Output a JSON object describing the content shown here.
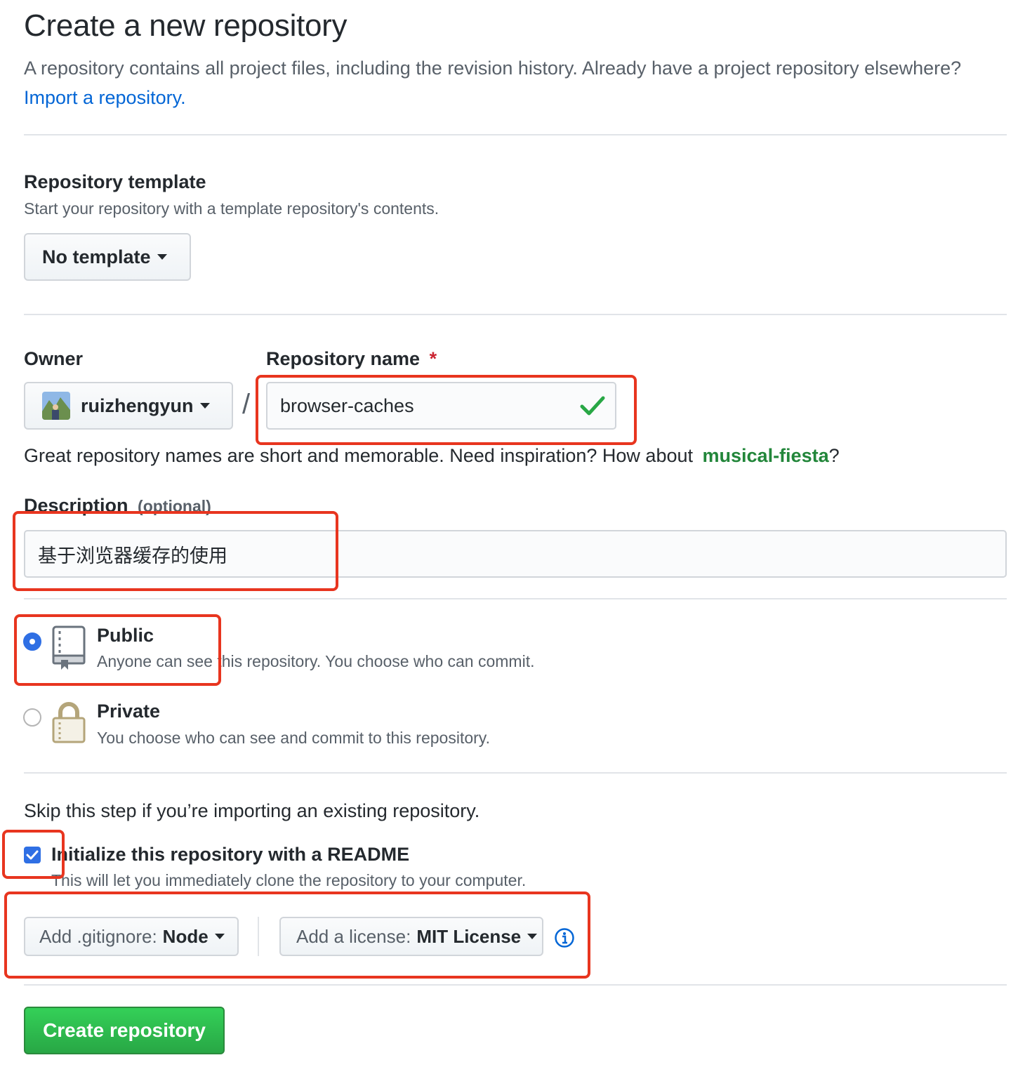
{
  "header": {
    "title": "Create a new repository",
    "subtitle_text": "A repository contains all project files, including the revision history. Already have a project repository elsewhere?",
    "import_link": "Import a repository."
  },
  "template": {
    "heading": "Repository template",
    "note": "Start your repository with a template repository's contents.",
    "button_label": "No template"
  },
  "owner": {
    "label": "Owner",
    "value": "ruizhengyun"
  },
  "separator": "/",
  "repo_name": {
    "label": "Repository name",
    "required_mark": "*",
    "value": "browser-caches"
  },
  "suggestion": {
    "prefix": "Great repository names are short and memorable. Need inspiration? How about",
    "name": "musical-fiesta",
    "suffix": "?"
  },
  "description": {
    "label": "Description",
    "optional": "(optional)",
    "value": "基于浏览器缓存的使用"
  },
  "visibility": {
    "public": {
      "title": "Public",
      "note": "Anyone can see this repository. You choose who can commit.",
      "selected": true
    },
    "private": {
      "title": "Private",
      "note": "You choose who can see and commit to this repository.",
      "selected": false
    }
  },
  "init": {
    "skip_note": "Skip this step if you’re importing an existing repository.",
    "readme_label": "Initialize this repository with a README",
    "readme_checked": true,
    "readme_note": "This will let you immediately clone the repository to your computer."
  },
  "gitignore": {
    "label": "Add .gitignore:",
    "value": "Node"
  },
  "license": {
    "label": "Add a license:",
    "value": "MIT License"
  },
  "submit_label": "Create repository",
  "colors": {
    "accent_blue": "#0366d6",
    "success_green": "#28a745",
    "highlight_red": "#e8351f",
    "required_red": "#cb2431"
  }
}
